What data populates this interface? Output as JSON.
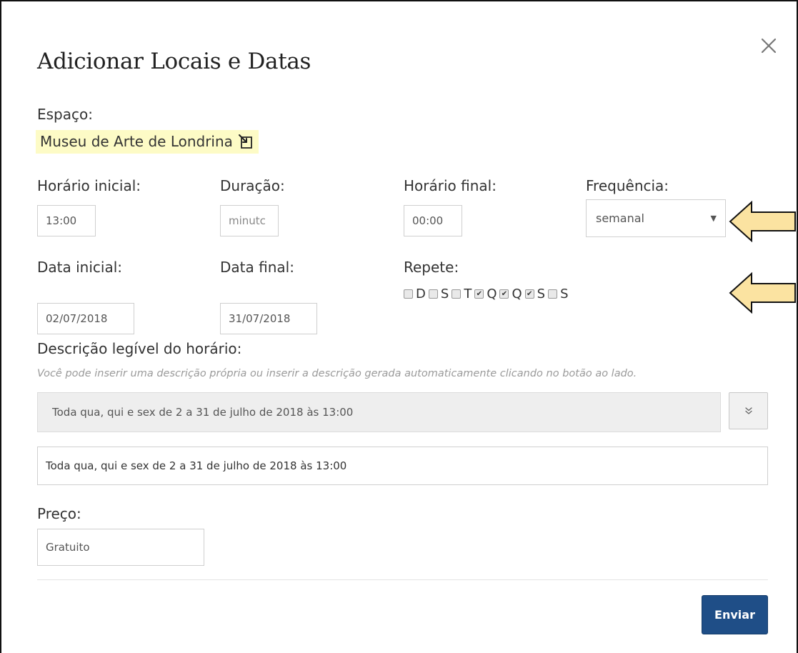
{
  "dialog": {
    "title": "Adicionar Locais e Datas",
    "close_label": "×"
  },
  "space": {
    "label": "Espaço:",
    "value": "Museu de Arte de Londrina"
  },
  "fields": {
    "start_time": {
      "label": "Horário inicial:",
      "value": "13:00"
    },
    "duration": {
      "label": "Duração:",
      "placeholder": "minutos",
      "display": "minutϲ"
    },
    "end_time": {
      "label": "Horário final:",
      "value": "00:00"
    },
    "frequency": {
      "label": "Frequência:",
      "selected": "semanal"
    },
    "start_date": {
      "label": "Data inicial:",
      "value": "02/07/2018"
    },
    "end_date": {
      "label": "Data final:",
      "value": "31/07/2018"
    }
  },
  "repeat": {
    "label": "Repete:",
    "days": [
      {
        "letter": "D",
        "checked": false
      },
      {
        "letter": "S",
        "checked": false
      },
      {
        "letter": "T",
        "checked": false
      },
      {
        "letter": "Q",
        "checked": true
      },
      {
        "letter": "Q",
        "checked": true
      },
      {
        "letter": "S",
        "checked": true
      },
      {
        "letter": "S",
        "checked": false
      }
    ]
  },
  "description": {
    "label": "Descrição legível do horário:",
    "hint": "Você pode inserir uma descrição própria ou inserir a descrição gerada automaticamente clicando no botão ao lado.",
    "generated": "Toda qua, qui e sex de 2 a 31 de julho de 2018 às 13:00",
    "value": "Toda qua, qui e sex de 2 a 31 de julho de 2018 às 13:00"
  },
  "price": {
    "label": "Preço:",
    "value": "Gratuito"
  },
  "actions": {
    "submit_label": "Enviar"
  },
  "colors": {
    "primary_button": "#1f4e87",
    "highlight": "#fdfbc6",
    "arrow_fill": "#fbe3a1"
  }
}
